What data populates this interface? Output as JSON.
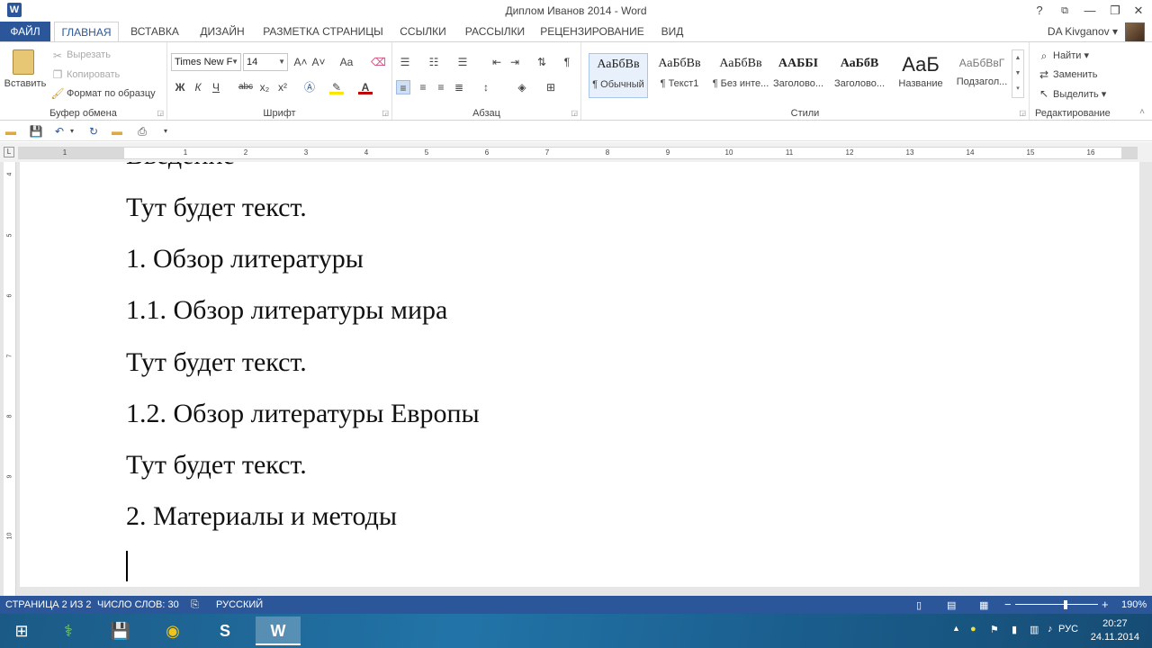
{
  "window": {
    "title": "Диплом Иванов 2014 - Word",
    "app_logo": "W",
    "help": "?",
    "restore_ribbon": "⧉",
    "minimize": "—",
    "maximize": "❐",
    "close": "✕"
  },
  "tabs": {
    "file": "ФАЙЛ",
    "items": [
      "ГЛАВНАЯ",
      "ВСТАВКА",
      "ДИЗАЙН",
      "РАЗМЕТКА СТРАНИЦЫ",
      "ССЫЛКИ",
      "РАССЫЛКИ",
      "РЕЦЕНЗИРОВАНИЕ",
      "ВИД"
    ],
    "active": "ГЛАВНАЯ",
    "user": "DA Kivganov ▾"
  },
  "ribbon": {
    "clipboard": {
      "paste": "Вставить",
      "cut": "Вырезать",
      "copy": "Копировать",
      "format_painter": "Формат по образцу",
      "label": "Буфер обмена"
    },
    "font": {
      "font_name": "Times New F",
      "font_size": "14",
      "bold": "Ж",
      "italic": "К",
      "underline": "Ч",
      "strike": "abc",
      "subscript": "x₂",
      "superscript": "x²",
      "grow": "A˄",
      "shrink": "A˅",
      "case": "Aa",
      "label": "Шрифт"
    },
    "paragraph": {
      "pilcrow": "¶",
      "label": "Абзац"
    },
    "styles": {
      "items": [
        {
          "sample": "АаБбВв",
          "name": "¶ Обычный"
        },
        {
          "sample": "АаБбВв",
          "name": "¶ Текст1"
        },
        {
          "sample": "АаБбВв",
          "name": "¶ Без инте..."
        },
        {
          "sample": "ААББI",
          "name": "Заголово..."
        },
        {
          "sample": "АаБбВ",
          "name": "Заголово..."
        },
        {
          "sample": "АаБ",
          "name": "Название"
        },
        {
          "sample": "АаБбВвГ",
          "name": "Подзагол..."
        }
      ],
      "label": "Стили"
    },
    "editing": {
      "find": "Найти ▾",
      "replace": "Заменить",
      "select": "Выделить ▾",
      "label": "Редактирование"
    }
  },
  "ruler": {
    "tab_selector": "L",
    "ticks": [
      "1",
      "1",
      "2",
      "3",
      "4",
      "5",
      "6",
      "7",
      "8",
      "9",
      "10",
      "11",
      "12",
      "13",
      "14",
      "15",
      "16"
    ],
    "vticks": [
      "4",
      "5",
      "6",
      "7",
      "8",
      "9",
      "10"
    ]
  },
  "document": {
    "paragraphs": [
      "Введение",
      "Тут будет текст.",
      "1. Обзор литературы",
      "1.1. Обзор литературы мира",
      "Тут будет текст.",
      "1.2. Обзор литературы Европы",
      "Тут будет текст.",
      "2. Материалы и методы"
    ]
  },
  "status": {
    "page": "СТРАНИЦА 2 ИЗ 2",
    "words": "ЧИСЛО СЛОВ: 30",
    "language": "РУССКИЙ",
    "zoom": "190%",
    "zoom_minus": "−",
    "zoom_plus": "+"
  },
  "taskbar": {
    "lang": "РУС",
    "time": "20:27",
    "date": "24.11.2014"
  }
}
